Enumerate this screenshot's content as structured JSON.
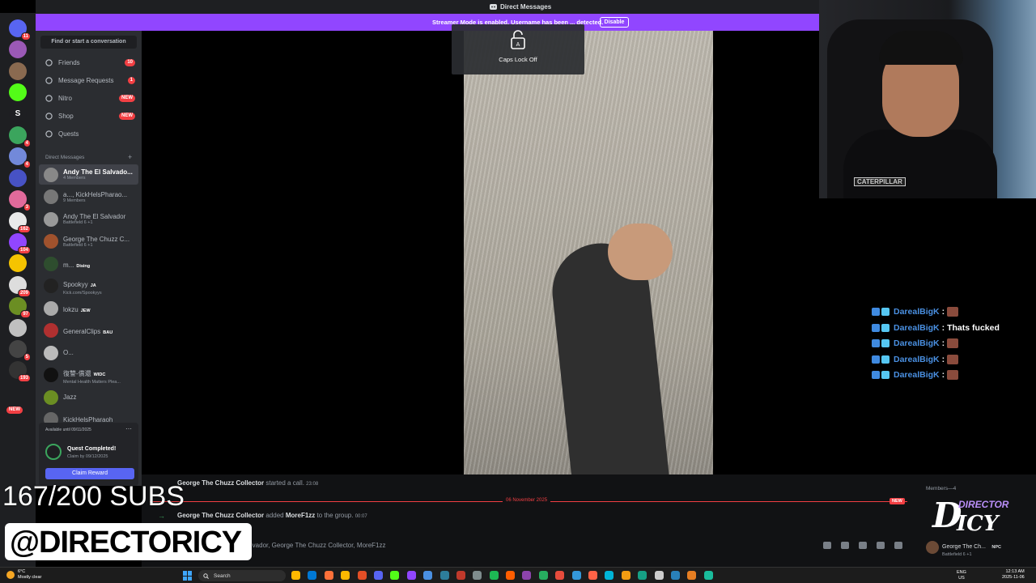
{
  "window": {
    "title": "Direct Messages"
  },
  "banner": {
    "text": "Streamer Mode is enabled. Username has been ... detected.",
    "disable_label": "Disable"
  },
  "caps_lock": {
    "label": "Caps Lock Off"
  },
  "rail": {
    "servers": [
      {
        "icon": "discord-home-icon",
        "badge": "11",
        "color": "#5865f2"
      },
      {
        "icon": "server-avatar-icon",
        "badge": "",
        "color": "#9b59b6"
      },
      {
        "icon": "server-avatar-icon",
        "badge": "",
        "color": "#8a6a50"
      },
      {
        "icon": "kick-icon",
        "badge": "",
        "color": "#53fc18"
      },
      {
        "icon": "server-letter-icon",
        "label": "S",
        "badge": "",
        "color": "#1e1f22"
      },
      {
        "icon": "server-avatar-icon",
        "badge": "4",
        "color": "#3ba55d"
      },
      {
        "icon": "server-avatar-icon",
        "badge": "4",
        "color": "#7289da"
      },
      {
        "icon": "folder-icon",
        "badge": "",
        "color": "#4752c4"
      },
      {
        "icon": "server-avatar-icon",
        "badge": "3",
        "color": "#e26a9b"
      },
      {
        "icon": "server-avatar-icon",
        "badge": "162",
        "color": "#e9e9e9"
      },
      {
        "icon": "server-avatar-icon",
        "badge": "104",
        "color": "#9146ff"
      },
      {
        "icon": "server-avatar-icon",
        "badge": "",
        "color": "#f5c400"
      },
      {
        "icon": "server-avatar-icon",
        "badge": "209",
        "color": "#ddd"
      },
      {
        "icon": "server-avatar-icon",
        "badge": "97",
        "color": "#6b8e23"
      },
      {
        "icon": "server-avatar-icon",
        "badge": "",
        "color": "#c0c0c0"
      },
      {
        "icon": "server-avatar-icon",
        "badge": "5",
        "color": "#444"
      },
      {
        "icon": "server-avatar-icon",
        "badge": "193",
        "color": "#333"
      }
    ],
    "new_label": "NEW"
  },
  "sidebar": {
    "search_label": "Find or start a conversation",
    "nav": [
      {
        "label": "Friends",
        "icon": "friends-icon",
        "pill": "10"
      },
      {
        "label": "Message Requests",
        "icon": "message-requests-icon",
        "pill": "1"
      },
      {
        "label": "Nitro",
        "icon": "nitro-icon",
        "pill": "NEW"
      },
      {
        "label": "Shop",
        "icon": "shop-icon",
        "pill": "NEW"
      },
      {
        "label": "Quests",
        "icon": "quests-icon",
        "pill": ""
      }
    ],
    "dm_header": "Direct Messages",
    "dms": [
      {
        "name": "Andy The El Salvado...",
        "status": "4 Members",
        "tag": "",
        "color": "#888"
      },
      {
        "name": "a..., KickHelsPharao...",
        "status": "9 Members",
        "tag": "",
        "color": "#777"
      },
      {
        "name": "Andy The El Salvador",
        "status": "Battlefield 6 +1",
        "tag": "",
        "color": "#999"
      },
      {
        "name": "George The Chuzz C...",
        "status": "Battlefield 6 +1",
        "tag": "",
        "color": "#a0522d"
      },
      {
        "name": "m...",
        "status": "",
        "tag": "Dising",
        "color": "#2e4d2e"
      },
      {
        "name": "Spookyy",
        "status": "Kick.com/Spookyys",
        "tag": "JA",
        "color": "#222"
      },
      {
        "name": "lokzu",
        "status": "",
        "tag": "JEW",
        "color": "#aaa"
      },
      {
        "name": "GeneralClips",
        "status": "",
        "tag": "BAU",
        "color": "#b03030"
      },
      {
        "name": "O...",
        "status": "",
        "tag": "",
        "color": "#bbb"
      },
      {
        "name": "復讐-償還",
        "status": "Mental Health Matters Plea...",
        "tag": "WIDC",
        "color": "#111"
      },
      {
        "name": "Jazz",
        "status": "",
        "tag": "",
        "color": "#6b8e23"
      },
      {
        "name": "KickHelsPharaoh",
        "status": "",
        "tag": "",
        "color": "#666"
      }
    ],
    "quest": {
      "available": "Available until 09/11/2025",
      "title": "Quest Completed!",
      "subtitle": "Claim by 09/12/2025",
      "claim_label": "Claim Reward"
    }
  },
  "chat": {
    "call_msg": {
      "user": "George The Chuzz Collector",
      "text": "started a call.",
      "time": "23:08"
    },
    "divider_label": "06 November 2025",
    "new_label": "NEW",
    "add_msg": {
      "user": "George The Chuzz Collector",
      "text_a": "added",
      "target": "MoreF1zz",
      "text_b": "to the group.",
      "time": "00:07"
    },
    "typing_text": "...vador, George The Chuzz Collector, MoreF1zz"
  },
  "members": {
    "header": "Members—4",
    "member": {
      "name": "George The Ch...",
      "status": "Battlefield 6 +1",
      "tag": "NPC"
    }
  },
  "overlay": {
    "subs": "167/200 SUBS",
    "handle": "@DIRECTORICY",
    "logo_line1": "DIRECTOR",
    "logo_line2": "ICY",
    "logo_letter": "D",
    "webcam_shirt": "CATERPILLAR",
    "chat": [
      {
        "user": "DarealBigK",
        "msg": ""
      },
      {
        "user": "DarealBigK",
        "msg": "Thats fucked"
      },
      {
        "user": "DarealBigK",
        "msg": ""
      },
      {
        "user": "DarealBigK",
        "msg": ""
      },
      {
        "user": "DarealBigK",
        "msg": ""
      }
    ]
  },
  "taskbar": {
    "weather_temp": "6°C",
    "weather_desc": "Mostly clear",
    "search_label": "Search",
    "lang1": "ENG",
    "lang2": "US",
    "time": "12:13 AM",
    "date": "2025-11-06",
    "apps": [
      "#ffb900",
      "#0078d4",
      "#ff7139",
      "#ffb900",
      "#e34f26",
      "#5865f2",
      "#53fc18",
      "#9146ff",
      "#4a90e2",
      "#2d7d9a",
      "#c0392b",
      "#7f8c8d",
      "#1db954",
      "#ff5e00",
      "#8e44ad",
      "#27ae60",
      "#e74c3c",
      "#3498db",
      "#ff6347",
      "#00b4d8",
      "#f39c12",
      "#16a085",
      "#ccc",
      "#2980b9",
      "#e67e22",
      "#1abc9c"
    ]
  }
}
